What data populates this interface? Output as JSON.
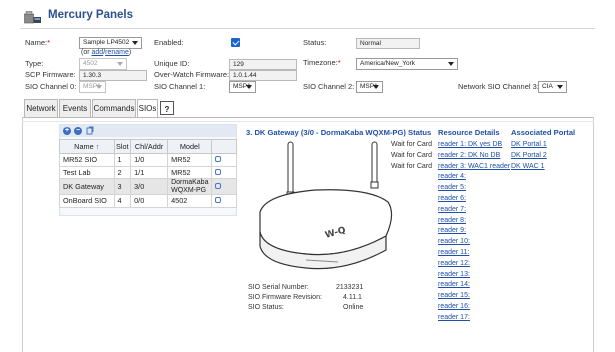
{
  "header": {
    "title": "Mercury Panels",
    "icon": "panel-icon"
  },
  "form": {
    "name_label": "Name:",
    "name_req": "*",
    "name_value": "Sample LP4502",
    "or_text": "(or",
    "add_link": "add",
    "rename_link": "rename",
    "close_paren": ")",
    "enabled_label": "Enabled:",
    "status_label": "Status:",
    "status_value": "Normal",
    "type_label": "Type:",
    "type_value": "4502",
    "unique_id_label": "Unique ID:",
    "unique_id_value": "129",
    "timezone_label": "Timezone:",
    "timezone_req": "*",
    "timezone_value": "America/New_York",
    "scp_fw_label": "SCP Firmware:",
    "scp_fw_value": "1.30.3",
    "ow_fw_label": "Over-Watch Firmware:",
    "ow_fw_value": "1.0.1.44",
    "sio0_label": "SIO Channel 0:",
    "sio0_value": "MSP1",
    "sio1_label": "SIO Channel 1:",
    "sio1_value": "MSP1",
    "sio2_label": "SIO Channel 2:",
    "sio2_value": "MSP1",
    "net_sio3_label": "Network SIO Channel 3:",
    "net_sio3_value": "CIA"
  },
  "tabs": [
    {
      "label": "Network"
    },
    {
      "label": "Events"
    },
    {
      "label": "Commands"
    },
    {
      "label": "SIOs"
    },
    {
      "label": "?"
    }
  ],
  "sio_table": {
    "headers": [
      "Name",
      "Slot",
      "Chl/Addr",
      "Model"
    ],
    "sort_indicator": "↑",
    "rows": [
      {
        "name": "MR52 SIO",
        "slot": "1",
        "chl": "1/0",
        "model": "MR52"
      },
      {
        "name": "Test Lab",
        "slot": "2",
        "chl": "1/1",
        "model": "MR52"
      },
      {
        "name": "DK Gateway",
        "slot": "3",
        "chl": "3/0",
        "model_line1": "DormaKaba",
        "model_line2": "WQXM-PG"
      },
      {
        "name": "OnBoard SIO",
        "slot": "4",
        "chl": "0/0",
        "model": "4502"
      }
    ]
  },
  "detail": {
    "title": "3. DK Gateway (3/0 - DormaKaba WQXM-PG)",
    "col_status": "Status",
    "col_resource": "Resource Details",
    "col_portal": "Associated Portal",
    "readers": [
      {
        "status": "Wait for Card",
        "label": "reader 1: DK yes DB",
        "portal": "DK Portal 1"
      },
      {
        "status": "Wait for Card",
        "label": "reader 2: DK No DB",
        "portal": "DK Portal 2"
      },
      {
        "status": "Wait for Card",
        "label": "reader 3: WAC1 reader",
        "portal": "DK WAC 1"
      },
      {
        "status": "",
        "label": "reader 4:",
        "portal": ""
      },
      {
        "status": "",
        "label": "reader 5:",
        "portal": ""
      },
      {
        "status": "",
        "label": "reader 6:",
        "portal": ""
      },
      {
        "status": "",
        "label": "reader 7:",
        "portal": ""
      },
      {
        "status": "",
        "label": "reader 8:",
        "portal": ""
      },
      {
        "status": "",
        "label": "reader 9:",
        "portal": ""
      },
      {
        "status": "",
        "label": "reader 10:",
        "portal": ""
      },
      {
        "status": "",
        "label": "reader 11:",
        "portal": ""
      },
      {
        "status": "",
        "label": "reader 12:",
        "portal": ""
      },
      {
        "status": "",
        "label": "reader 13:",
        "portal": ""
      },
      {
        "status": "",
        "label": "reader 14:",
        "portal": ""
      },
      {
        "status": "",
        "label": "reader 15:",
        "portal": ""
      },
      {
        "status": "",
        "label": "reader 16:",
        "portal": ""
      },
      {
        "status": "",
        "label": "reader 17:",
        "portal": ""
      }
    ],
    "serial_label": "SIO Serial Number:",
    "serial_value": "2133231",
    "fw_label": "SIO Firmware Revision:",
    "fw_value": "4.11.1",
    "status_label": "SIO Status:",
    "status_value": "Online",
    "device_logo": "W-Q"
  },
  "colors": {
    "accent": "#1f4fa8",
    "title": "#2d4f8a",
    "checkbox": "#1a66cc"
  }
}
